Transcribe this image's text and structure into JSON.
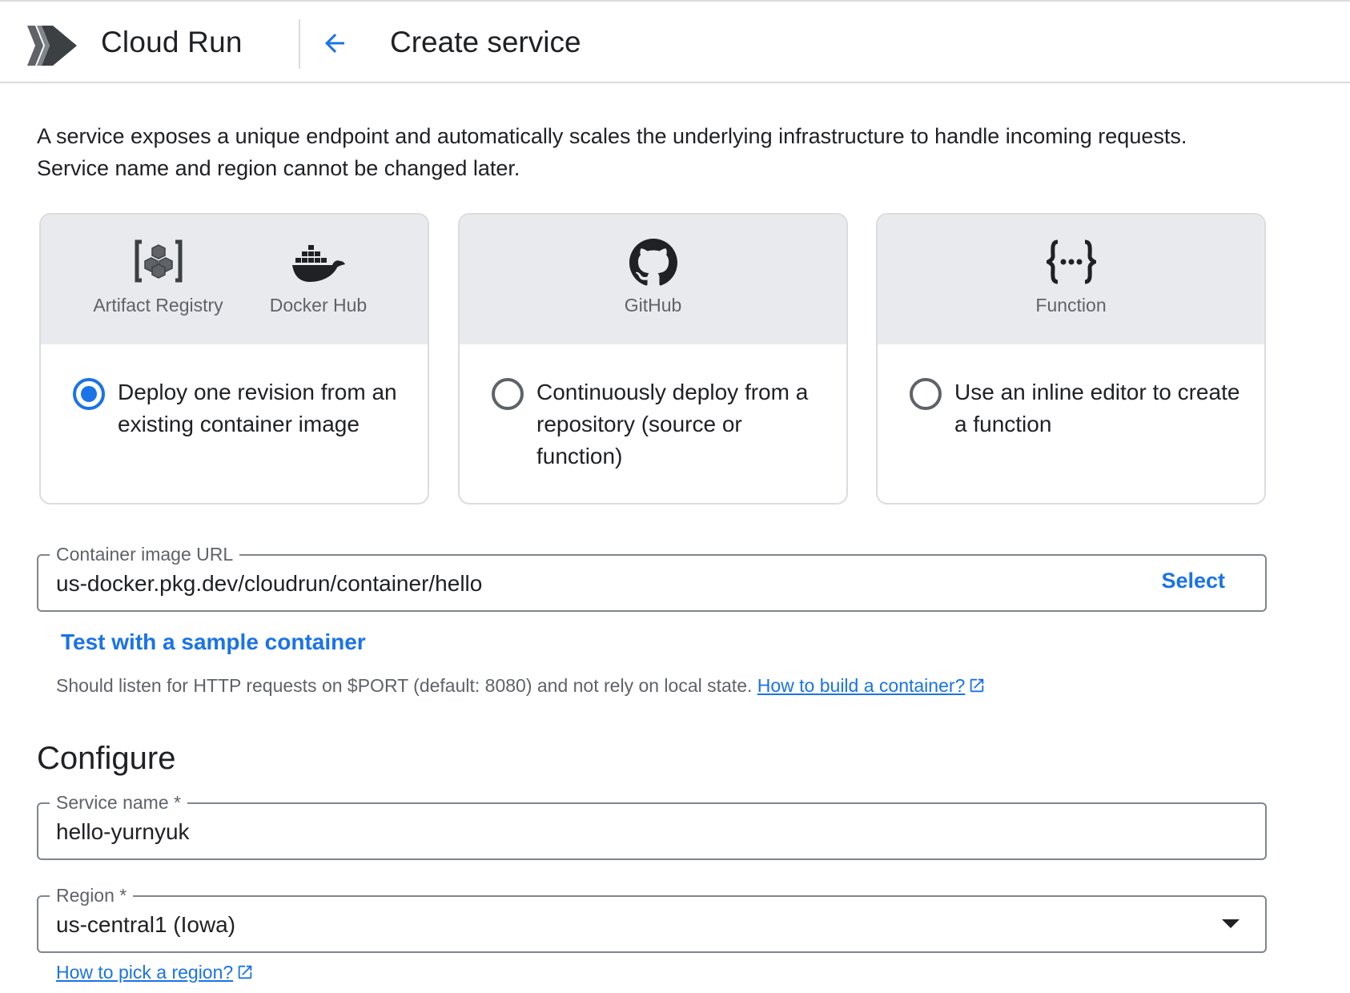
{
  "header": {
    "product_name": "Cloud Run",
    "page_title": "Create service"
  },
  "intro": {
    "line1": "A service exposes a unique endpoint and automatically scales the underlying infrastructure to handle incoming requests.",
    "line2": "Service name and region cannot be changed later."
  },
  "source_options": [
    {
      "sources": [
        {
          "icon": "artifact-registry-icon",
          "label": "Artifact Registry"
        },
        {
          "icon": "docker-icon",
          "label": "Docker Hub"
        }
      ],
      "description": "Deploy one revision from an existing container image",
      "selected": true
    },
    {
      "sources": [
        {
          "icon": "github-icon",
          "label": "GitHub"
        }
      ],
      "description": "Continuously deploy from a repository (source or function)",
      "selected": false
    },
    {
      "sources": [
        {
          "icon": "function-icon",
          "label": "Function"
        }
      ],
      "description": "Use an inline editor to create a function",
      "selected": false
    }
  ],
  "container_image": {
    "label": "Container image URL",
    "value": "us-docker.pkg.dev/cloudrun/container/hello",
    "select_label": "Select"
  },
  "sample_link": "Test with a sample container",
  "hint": {
    "text": "Should listen for HTTP requests on $PORT (default: 8080) and not rely on local state.",
    "link": "How to build a container?"
  },
  "configure": {
    "title": "Configure",
    "service_name": {
      "label": "Service name *",
      "value": "hello-yurnyuk"
    },
    "region": {
      "label": "Region *",
      "value": "us-central1 (Iowa)"
    },
    "region_help": "How to pick a region?"
  },
  "colors": {
    "accent": "#1a73e8",
    "card_header_bg": "#e8eaed",
    "border": "#dadce0",
    "text": "#202124",
    "muted_text": "#5f6368"
  }
}
